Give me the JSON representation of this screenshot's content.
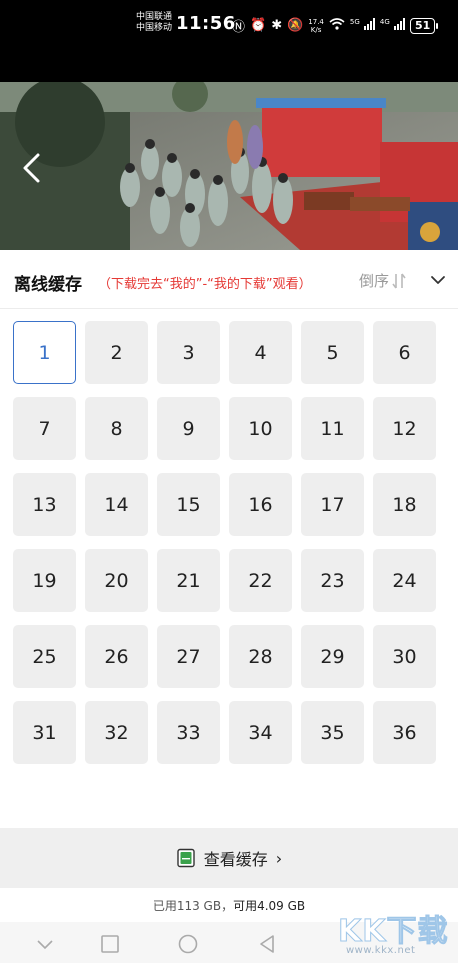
{
  "status_bar": {
    "carrier1": "中国联通",
    "carrier2": "中国移动",
    "time": "11:56",
    "net_speed_value": "17.4",
    "net_speed_unit": "K/s",
    "sim1_label": "5G",
    "sim2_label": "4G",
    "battery": "51"
  },
  "header": {
    "title": "离线缓存",
    "hint": "（下载完去“我的”-“我的下载”观看）",
    "sort_label": "倒序"
  },
  "episodes": {
    "selected": "1",
    "items": [
      "1",
      "2",
      "3",
      "4",
      "5",
      "6",
      "7",
      "8",
      "9",
      "10",
      "11",
      "12",
      "13",
      "14",
      "15",
      "16",
      "17",
      "18",
      "19",
      "20",
      "21",
      "22",
      "23",
      "24",
      "25",
      "26",
      "27",
      "28",
      "29",
      "30",
      "31",
      "32",
      "33",
      "34",
      "35",
      "36"
    ]
  },
  "cache_bar": {
    "label": "查看缓存",
    "arrow": "›"
  },
  "storage": {
    "used": "已用113 GB，",
    "available": "可用4.09 GB"
  },
  "watermark": {
    "text": "KK下载",
    "url": "www.kkx.net"
  },
  "colors": {
    "accent": "#3a72c9",
    "hint_red": "#e53935",
    "tile_bg": "#eeeeee"
  }
}
